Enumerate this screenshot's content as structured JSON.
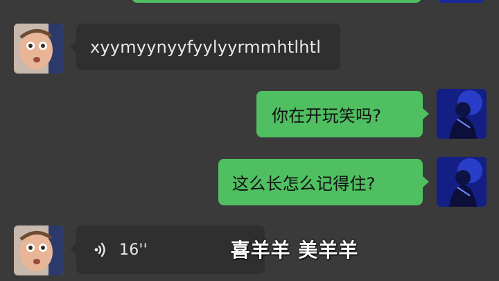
{
  "messages": {
    "m1_text": "xyymyynyyfyylyyrmmhtlhtl",
    "m2_text": "你在开玩笑吗?",
    "m3_text": "这么长怎么记得住?",
    "m4_voice_duration": "16''"
  },
  "caption": {
    "text": "喜羊羊 美羊羊"
  },
  "colors": {
    "background": "#3a3a3a",
    "incoming_bubble": "#2f2f2f",
    "outgoing_bubble": "#4fbf61"
  },
  "icons": {
    "voice": "voice-wave-icon"
  }
}
